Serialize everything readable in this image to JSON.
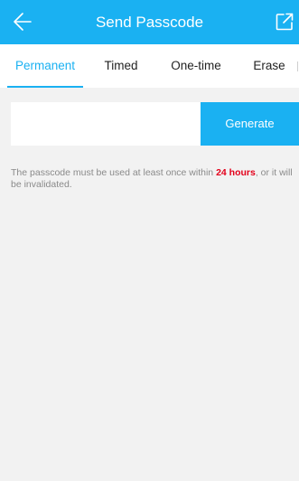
{
  "header": {
    "title": "Send Passcode",
    "back_icon": "arrow-left-icon",
    "share_icon": "external-share-icon",
    "background": "#1ab1f2"
  },
  "tabs": [
    {
      "label": "Permanent",
      "active": true
    },
    {
      "label": "Timed",
      "active": false
    },
    {
      "label": "One-time",
      "active": false
    },
    {
      "label": "Erase",
      "active": false
    }
  ],
  "passcode": {
    "value": "",
    "generate_label": "Generate"
  },
  "notice": {
    "before": "The passcode must be used at least once within ",
    "highlight": "24 hours",
    "after": ", or it will be invalidated.",
    "highlight_color": "#e3001b"
  },
  "colors": {
    "accent": "#1ab1f2",
    "background": "#f2f2f2",
    "text": "#222222",
    "muted": "#8a8a8a"
  }
}
